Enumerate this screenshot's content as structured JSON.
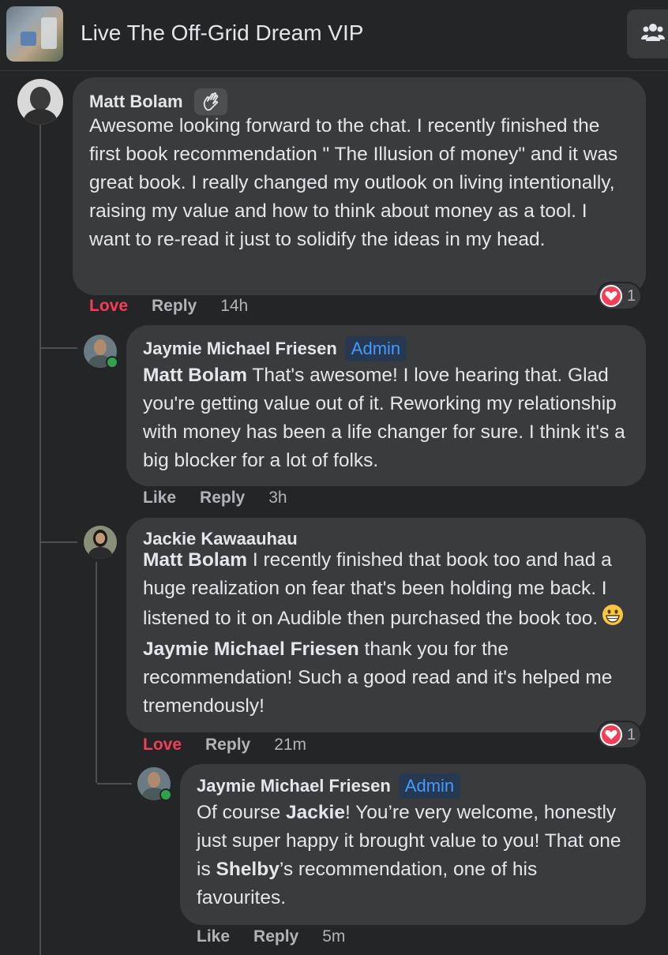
{
  "header": {
    "group_title": "Live The Off-Grid Dream VIP",
    "group_thumbnail_icon": "group-cover-photo",
    "members_icon": "members-icon"
  },
  "comments": [
    {
      "author": "Matt Bolam",
      "badge_icon": "wave-icon",
      "text": "Awesome looking forward to the chat. I recently finished the first book recommendation \" The Illusion of money\" and it was great book. I really changed my outlook on living intentionally, raising my value and how to think about money as a tool. I want to re-read it just to solidify the ideas in my head.",
      "action_react": "Love",
      "action_reply": "Reply",
      "time": "14h",
      "reaction_icon": "heart-icon",
      "reaction_count": "1"
    },
    {
      "author": "Jaymie Michael Friesen",
      "badge": "Admin",
      "mention": "Matt Bolam",
      "text": " That's awesome! I love hearing that. Glad you're getting value out of it. Reworking my relationship with money has been a life changer for sure. I think it's a big blocker for a lot of folks.",
      "action_react": "Like",
      "action_reply": "Reply",
      "time": "3h"
    },
    {
      "author": "Jackie Kawaauhau",
      "mention": "Matt Bolam",
      "text_part1": " I recently finished that book too and had a huge realization on fear that's been holding me back. I listened to it on Audible then purchased the book too.",
      "emoji_icon": "grinning-face-icon",
      "mention2": "Jaymie Michael Friesen",
      "text_part2": " thank you for the recommendation! Such a good read and it's helped me tremendously!",
      "action_react": "Love",
      "action_reply": "Reply",
      "time": "21m",
      "reaction_icon": "heart-icon",
      "reaction_count": "1"
    },
    {
      "author": "Jaymie Michael Friesen",
      "badge": "Admin",
      "text_part1": "Of course ",
      "mention": "Jackie",
      "text_part2": "! You’re very welcome, honestly just super happy it brought value to you! That one is ",
      "mention2": "Shelby",
      "text_part3": "’s recommendation, one of his favourites.",
      "action_react": "Like",
      "action_reply": "Reply",
      "time": "5m"
    }
  ],
  "colors": {
    "background": "#242526",
    "bubble": "#3a3b3c",
    "love": "#f33e58",
    "admin_badge": "#4599ff",
    "online": "#31a24c"
  }
}
